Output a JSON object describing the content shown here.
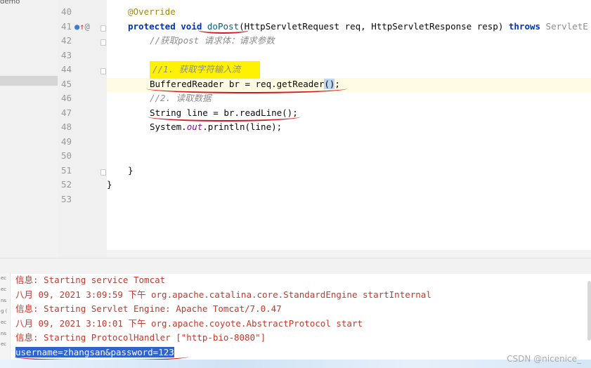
{
  "project": {
    "label": "demo"
  },
  "editor": {
    "line_numbers": [
      "40",
      "41",
      "42",
      "43",
      "44",
      "45",
      "46",
      "47",
      "48",
      "49",
      "50",
      "51",
      "52",
      "53"
    ],
    "lines": {
      "l40_annotation": "@Override",
      "l41_protected": "protected",
      "l41_void": "void",
      "l41_method": "doPost",
      "l41_params": "(HttpServletRequest req, HttpServletResponse resp) ",
      "l41_throws": "throws",
      "l41_tail": " ServletE",
      "l42_comment": "//获取post 请求体：请求参数",
      "l44_comment": "//1. 获取字符输入流",
      "l45_type": "BufferedReader br = req.getReader",
      "l45_paren": "()",
      "l45_end": ";",
      "l46_comment": "//2. 读取数据",
      "l47_code": "String line = br.readLine();",
      "l48_code_a": "System.",
      "l48_out": "out",
      "l48_code_b": ".println(line);",
      "l51_brace": "}",
      "l52_brace": "}"
    }
  },
  "console": {
    "lines": [
      "信息: Starting service Tomcat",
      "八月 09, 2021 3:09:59 下午 org.apache.catalina.core.StandardEngine startInternal",
      "信息: Starting Servlet Engine: Apache Tomcat/7.0.47",
      "八月 09, 2021 3:10:01 下午 org.apache.coyote.AbstractProtocol start",
      "信息: Starting ProtocolHandler [\"http-bio-8080\"]"
    ],
    "output": "username=zhangsan&password=123",
    "gutter_fragments": [
      "ec",
      "ec",
      "ns",
      "g (",
      "ec",
      "ns",
      "ec"
    ]
  },
  "watermark": "CSDN @nicenice_"
}
